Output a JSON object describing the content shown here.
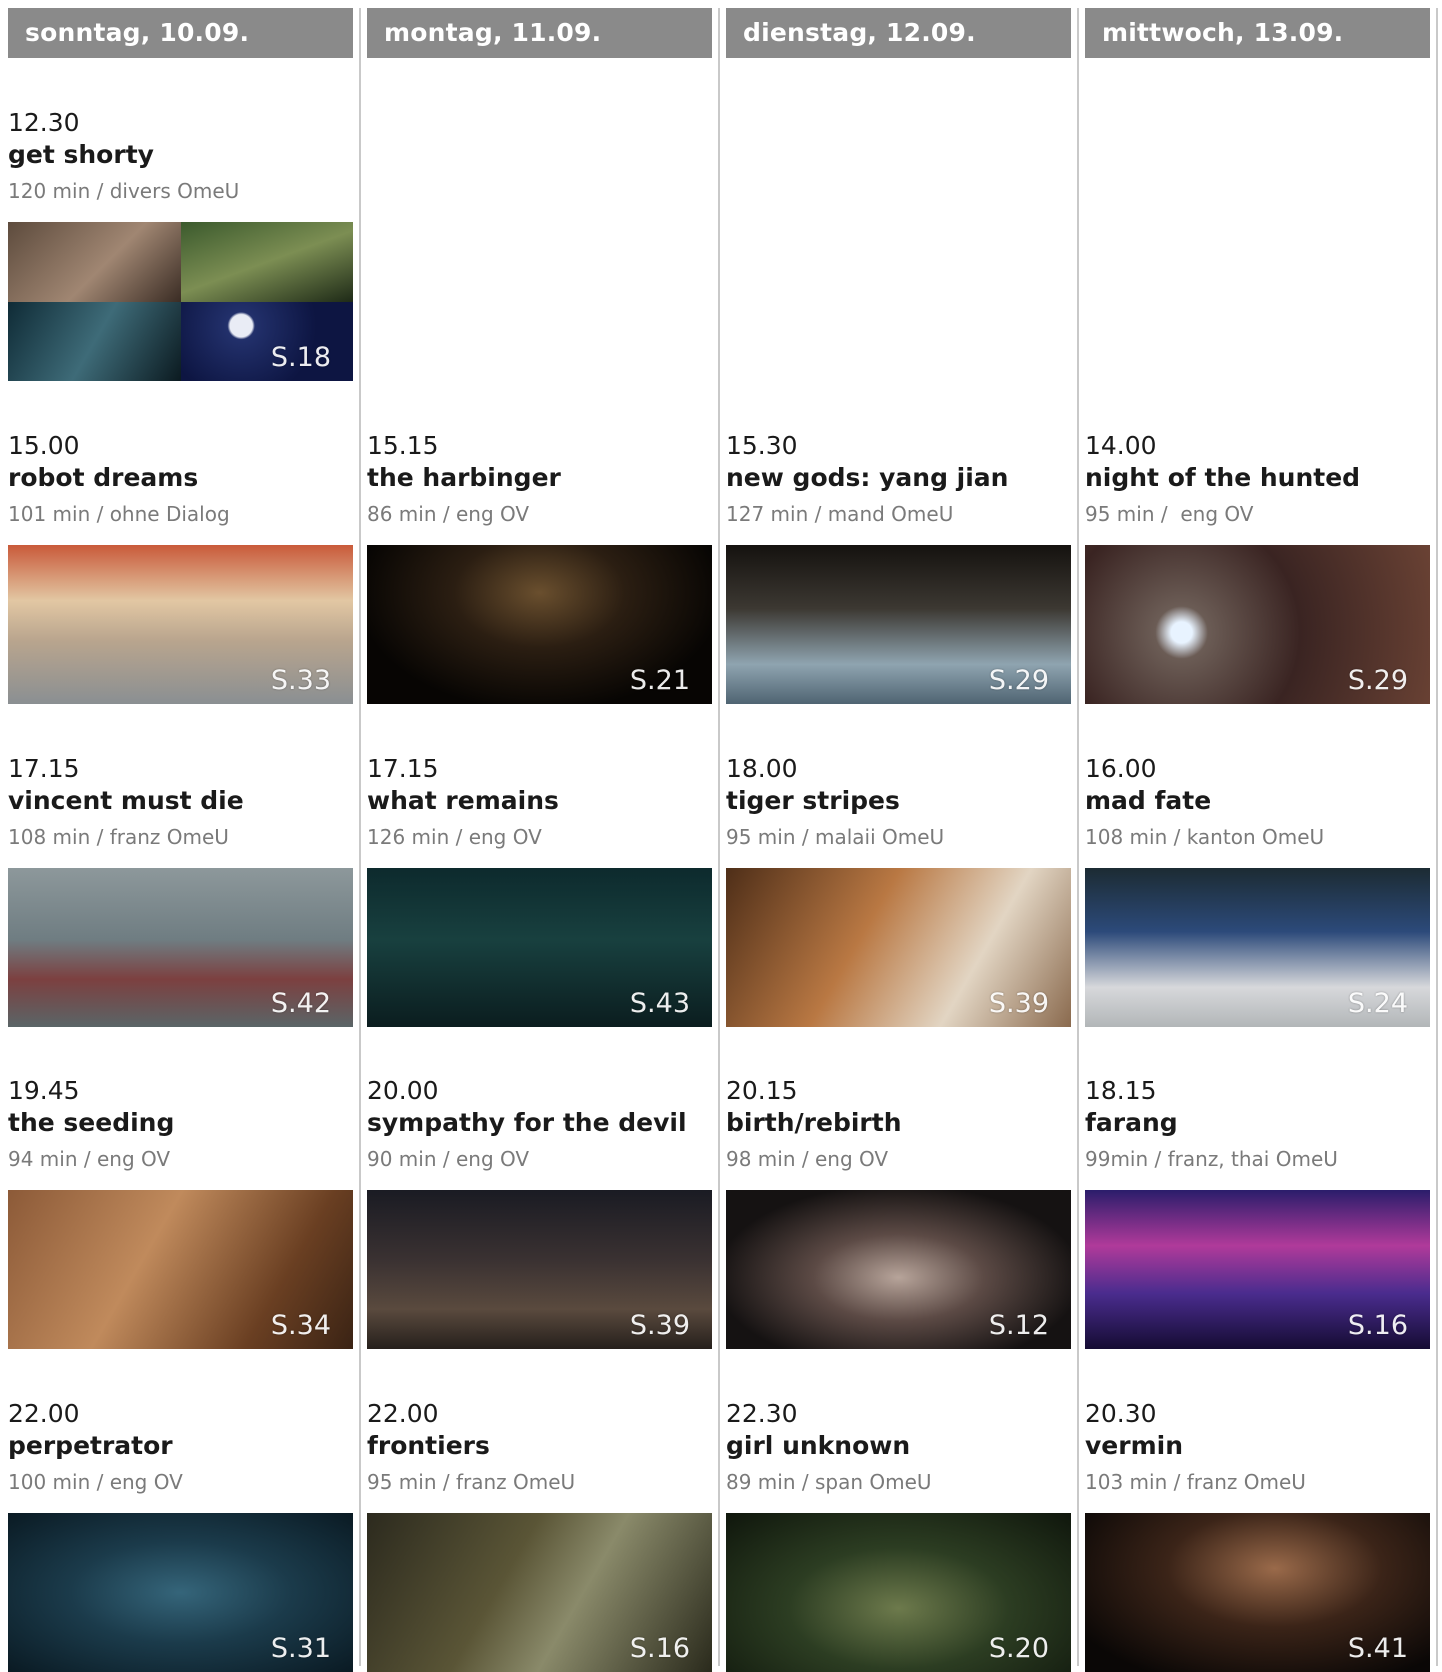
{
  "days": [
    {
      "header": "sonntag, 10.09.",
      "screenings": [
        {
          "time": "12.30",
          "title": "get shorty",
          "meta": "120 min / divers OmeU",
          "page": "S.18"
        },
        {
          "time": "15.00",
          "title": "robot dreams",
          "meta": "101 min / ohne Dialog",
          "page": "S.33"
        },
        {
          "time": "17.15",
          "title": "vincent must die",
          "meta": "108 min / franz OmeU",
          "page": "S.42"
        },
        {
          "time": "19.45",
          "title": "the seeding",
          "meta": "94 min / eng OV",
          "page": "S.34"
        },
        {
          "time": "22.00",
          "title": "perpetrator",
          "meta": "100 min / eng OV",
          "page": "S.31"
        }
      ]
    },
    {
      "header": "montag, 11.09.",
      "screenings": [
        {
          "time": "15.15",
          "title": "the harbinger",
          "meta": "86 min / eng OV",
          "page": "S.21"
        },
        {
          "time": "17.15",
          "title": "what remains",
          "meta": "126 min / eng OV",
          "page": "S.43"
        },
        {
          "time": "20.00",
          "title": "sympathy for the devil",
          "meta": "90 min / eng OV",
          "page": "S.39"
        },
        {
          "time": "22.00",
          "title": "frontiers",
          "meta": "95 min / franz OmeU",
          "page": "S.16"
        }
      ]
    },
    {
      "header": "dienstag, 12.09.",
      "screenings": [
        {
          "time": "15.30",
          "title": "new gods: yang jian",
          "meta": "127 min / mand OmeU",
          "page": "S.29"
        },
        {
          "time": "18.00",
          "title": "tiger stripes",
          "meta": "95 min / malaii OmeU",
          "page": "S.39"
        },
        {
          "time": "20.15",
          "title": "birth/rebirth",
          "meta": "98 min / eng OV",
          "page": "S.12"
        },
        {
          "time": "22.30",
          "title": "girl unknown",
          "meta": "89 min / span OmeU",
          "page": "S.20"
        }
      ]
    },
    {
      "header": "mittwoch, 13.09.",
      "screenings": [
        {
          "time": "14.00",
          "title": "night of the hunted",
          "meta": "95 min /  eng OV",
          "page": "S.29"
        },
        {
          "time": "16.00",
          "title": "mad fate",
          "meta": "108 min / kanton OmeU",
          "page": "S.24"
        },
        {
          "time": "18.15",
          "title": "farang",
          "meta": "99min / franz, thai OmeU",
          "page": "S.16"
        },
        {
          "time": "20.30",
          "title": "vermin",
          "meta": "103 min / franz OmeU",
          "page": "S.41"
        }
      ]
    }
  ]
}
